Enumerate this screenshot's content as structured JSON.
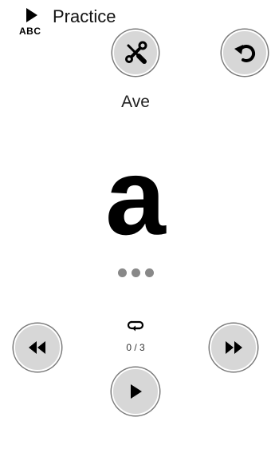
{
  "header": {
    "app_icon_label": "ABC",
    "title": "Practice"
  },
  "toolbar": {
    "tools_icon": "tools-icon",
    "undo_icon": "undo-icon"
  },
  "practice": {
    "word": "Ave",
    "letter": "a",
    "progress_dots": 3
  },
  "playback": {
    "repeat_icon": "repeat-icon",
    "counter": "0 / 3",
    "prev_icon": "rewind-icon",
    "next_icon": "fast-forward-icon",
    "play_icon": "play-icon"
  }
}
